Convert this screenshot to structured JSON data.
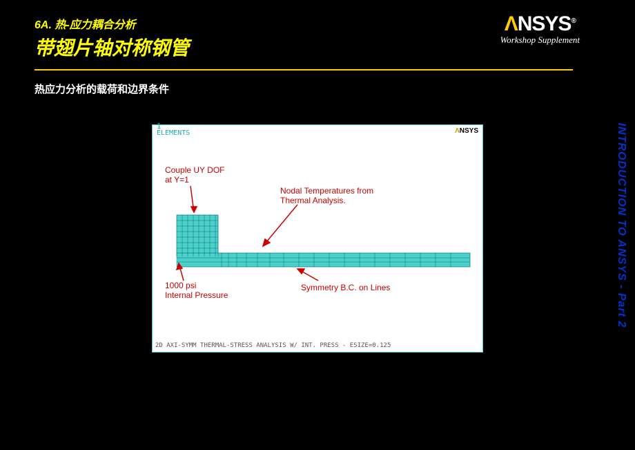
{
  "header": {
    "section": "6A. 热-应力耦合分析",
    "title": "带翅片轴对称钢管"
  },
  "logo": {
    "text_pre": "",
    "text_main": "NSYS",
    "sub": "Workshop Supplement",
    "reg": "®"
  },
  "subtitle": "热应力分析的载荷和边界条件",
  "figure": {
    "one": "1",
    "elements_label": "ELEMENTS",
    "tiny_logo_pre": "",
    "tiny_logo_main": "NSYS",
    "annotations": {
      "couple": "Couple UY DOF\nat Y=1",
      "nodal": "Nodal Temperatures from\nThermal Analysis.",
      "pressure": "1000 psi\nInternal Pressure",
      "symmetry": "Symmetry B.C. on Lines"
    },
    "footer": "2D AXI-SYMM THERMAL-STRESS ANALYSIS W/ INT. PRESS - ESIZE=0.125"
  },
  "sidebar": "INTRODUCTION TO ANSYS - Part 2"
}
